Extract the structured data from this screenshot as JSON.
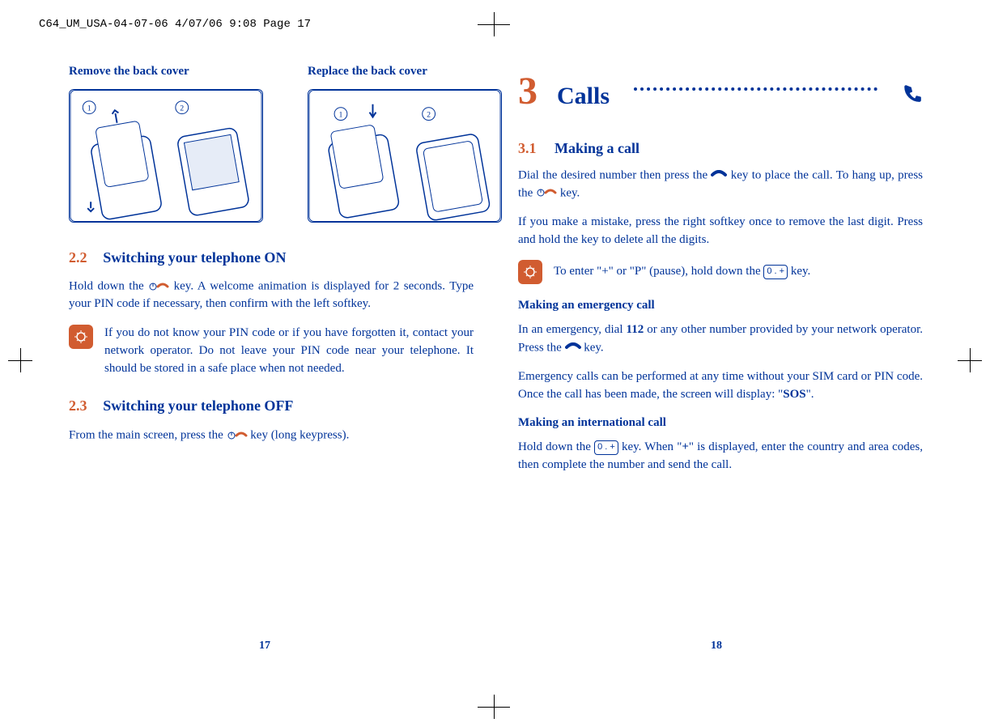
{
  "header": "C64_UM_USA-04-07-06  4/07/06  9:08  Page 17",
  "left": {
    "heading_remove": "Remove the back cover",
    "heading_replace": "Replace the back cover",
    "section22_num": "2.2",
    "section22_title": "Switching your telephone ON",
    "section22_para": "Hold down the  key. A welcome animation is displayed for 2 seconds. Type your PIN code if necessary, then confirm with the left softkey.",
    "section22_note": "If you do not know your PIN code or if you have forgotten it, contact your network operator. Do not leave your PIN code near your telephone. It should be stored in a safe place when not needed.",
    "section23_num": "2.3",
    "section23_title": "Switching your telephone OFF",
    "section23_para_a": "From the main screen, press the ",
    "section23_para_b": " key (long keypress).",
    "page_num": "17"
  },
  "right": {
    "chapter_num": "3",
    "chapter_title": "Calls",
    "section31_num": "3.1",
    "section31_title": "Making a call",
    "p1a": "Dial the desired number then press the ",
    "p1b": " key to place the call. To hang up, press the ",
    "p1c": " key.",
    "p2": "If you make a mistake, press the right softkey once to remove the last digit. Press and hold the key to delete all the digits.",
    "tip_a": "To enter \"+\" or \"P\" (pause), hold down the ",
    "tip_key": "0 . +",
    "tip_b": " key.",
    "h_emergency": "Making an emergency call",
    "p3a": "In an emergency, dial ",
    "p3_num": "112",
    "p3b": " or any other number provided by your network operator. Press the ",
    "p3c": " key.",
    "p4a": "Emergency calls can be performed at any time without your SIM card or PIN code. Once the call has been made, the screen will display: \"",
    "p4_sos": "SOS",
    "p4b": "\".",
    "h_intl": "Making an international call",
    "p5a": "Hold down the ",
    "p5_key": "0 . +",
    "p5b": " key. When \"",
    "p5_plus": "+",
    "p5c": "\" is displayed, enter the country and area codes, then complete the number and send the call.",
    "page_num": "18"
  }
}
